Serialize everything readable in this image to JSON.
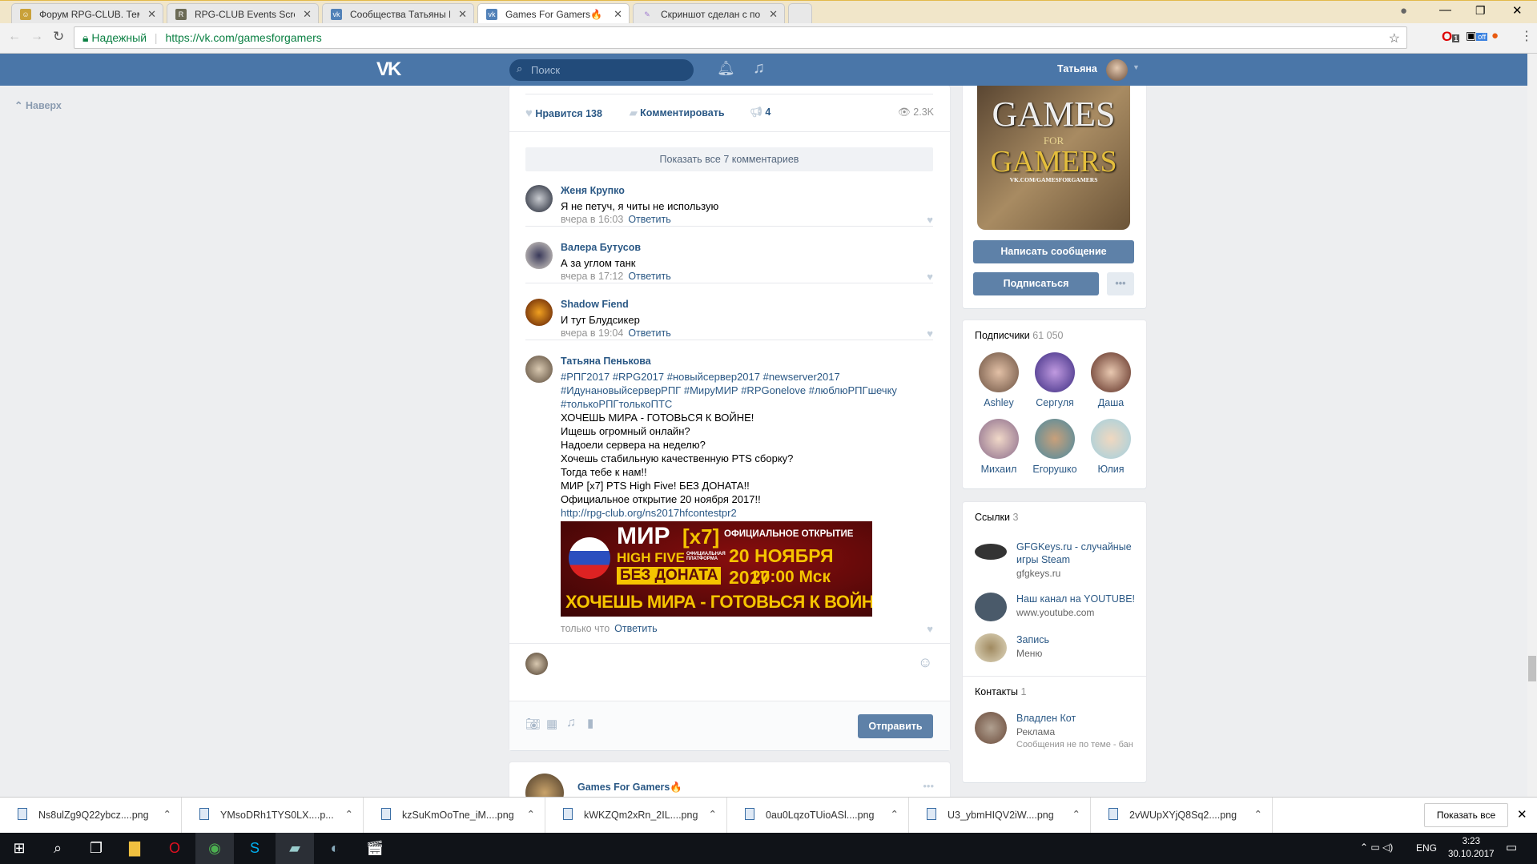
{
  "browser": {
    "tabs": [
      {
        "title": "Форум RPG-CLUB. Тема"
      },
      {
        "title": "RPG-CLUB Events Screen"
      },
      {
        "title": "Сообщества Татьяны П"
      },
      {
        "title": "Games For Gamers🔥"
      },
      {
        "title": "Скриншот сделан с пом"
      }
    ],
    "secure_label": "Надежный",
    "url": "https://vk.com/gamesforgamers",
    "ext_badge_1": "1",
    "ext_badge_2": "off"
  },
  "header": {
    "logo": "VK",
    "search_placeholder": "Поиск",
    "user_name": "Татьяна"
  },
  "left": {
    "back_to_top": "Наверх"
  },
  "post": {
    "likes_label": "Нравится",
    "likes_count": "138",
    "comment_label": "Комментировать",
    "shares": "4",
    "views": "2.3K",
    "show_all_comments": "Показать все 7 комментариев"
  },
  "comments": [
    {
      "author": "Женя Крупко",
      "text": "Я не петуч, я читы не использую",
      "time": "вчера в 16:03",
      "reply": "Ответить"
    },
    {
      "author": "Валера Бутусов",
      "text": "А за углом танк",
      "time": "вчера в 17:12",
      "reply": "Ответить"
    },
    {
      "author": "Shadow Fiend",
      "text": "И тут Блудсикер",
      "time": "вчера в 19:04",
      "reply": "Ответить"
    }
  ],
  "last_comment": {
    "author": "Татьяна Пенькова",
    "hashtags": [
      "#РПГ2017 #RPG2017 #новыйсервер2017 #newserver2017",
      "#ИдунановыйсерверРПГ #МируМИР #RPGonelove #люблюРПГшечку",
      "#толькоРПГтолькоПТС"
    ],
    "lines": [
      "ХОЧЕШЬ МИРА - ГОТОВЬСЯ К ВОЙНЕ!",
      "Ищешь огромный онлайн?",
      "Надоели сервера на неделю?",
      "Хочешь стабильную качественную PTS сборку?",
      "Тогда тебе к нам!!",
      "МИР [x7] PTS High Five! БЕЗ ДОНАТА!!",
      "Официальное открытие 20 ноября 2017!!"
    ],
    "link": "http://rpg-club.org/ns2017hfcontestpr2",
    "banner": {
      "title": "МИР",
      "rate": "[x7]",
      "chronicle": "HIGH FIVE",
      "platform": "ОФИЦИАЛЬНАЯ ПЛАТФОРМА",
      "no_donate": "БЕЗ ДОНАТА",
      "opening": "ОФИЦИАЛЬНОЕ ОТКРЫТИЕ",
      "date": "20 НОЯБРЯ 2017",
      "time": "20:00 Мск",
      "slogan": "ХОЧЕШЬ МИРА - ГОТОВЬСЯ К ВОЙНЕ"
    },
    "time": "только что",
    "reply": "Ответить"
  },
  "composer": {
    "send_label": "Отправить"
  },
  "next_post": {
    "author": "Games For Gamers🔥"
  },
  "right": {
    "cover": {
      "line1": "GAMES",
      "line2": "FOR",
      "line3": "GAMERS",
      "line4": "VK.COM/GAMESFORGAMERS"
    },
    "message_button": "Написать сообщение",
    "subscribe_button": "Подписаться",
    "subscribers": {
      "title": "Подписчики",
      "count": "61 050",
      "people": [
        "Ashley",
        "Сергуля",
        "Даша",
        "Михаил",
        "Егорушко",
        "Юлия"
      ]
    },
    "links": {
      "title": "Ссылки",
      "count": "3",
      "items": [
        {
          "title": "GFGKeys.ru - случайные игры Steam",
          "desc": "gfgkeys.ru"
        },
        {
          "title": "Наш канал на YOUTUBE!",
          "desc": "www.youtube.com"
        },
        {
          "title": "Запись",
          "desc": "Меню"
        }
      ]
    },
    "contacts": {
      "title": "Контакты",
      "count": "1",
      "name": "Владлен Кот",
      "role": "Реклама",
      "note": "Сообщения не по теме - бан"
    }
  },
  "downloads": {
    "files": [
      "Ns8ulZg9Q22ybcz....png",
      "YMsoDRh1TYS0LX....p...",
      "kzSuKmOoTne_iM....png",
      "kWKZQm2xRn_2IL....png",
      "0au0LqzoTUioASl....png",
      "U3_ybmHIQV2iW....png",
      "2vWUpXYjQ8Sq2....png"
    ],
    "show_all": "Показать все"
  },
  "taskbar": {
    "lang": "ENG",
    "time": "3:23",
    "date": "30.10.2017"
  },
  "colors": {
    "vk_blue": "#4a76a8",
    "button": "#5e81a8",
    "link": "#2a5885"
  }
}
